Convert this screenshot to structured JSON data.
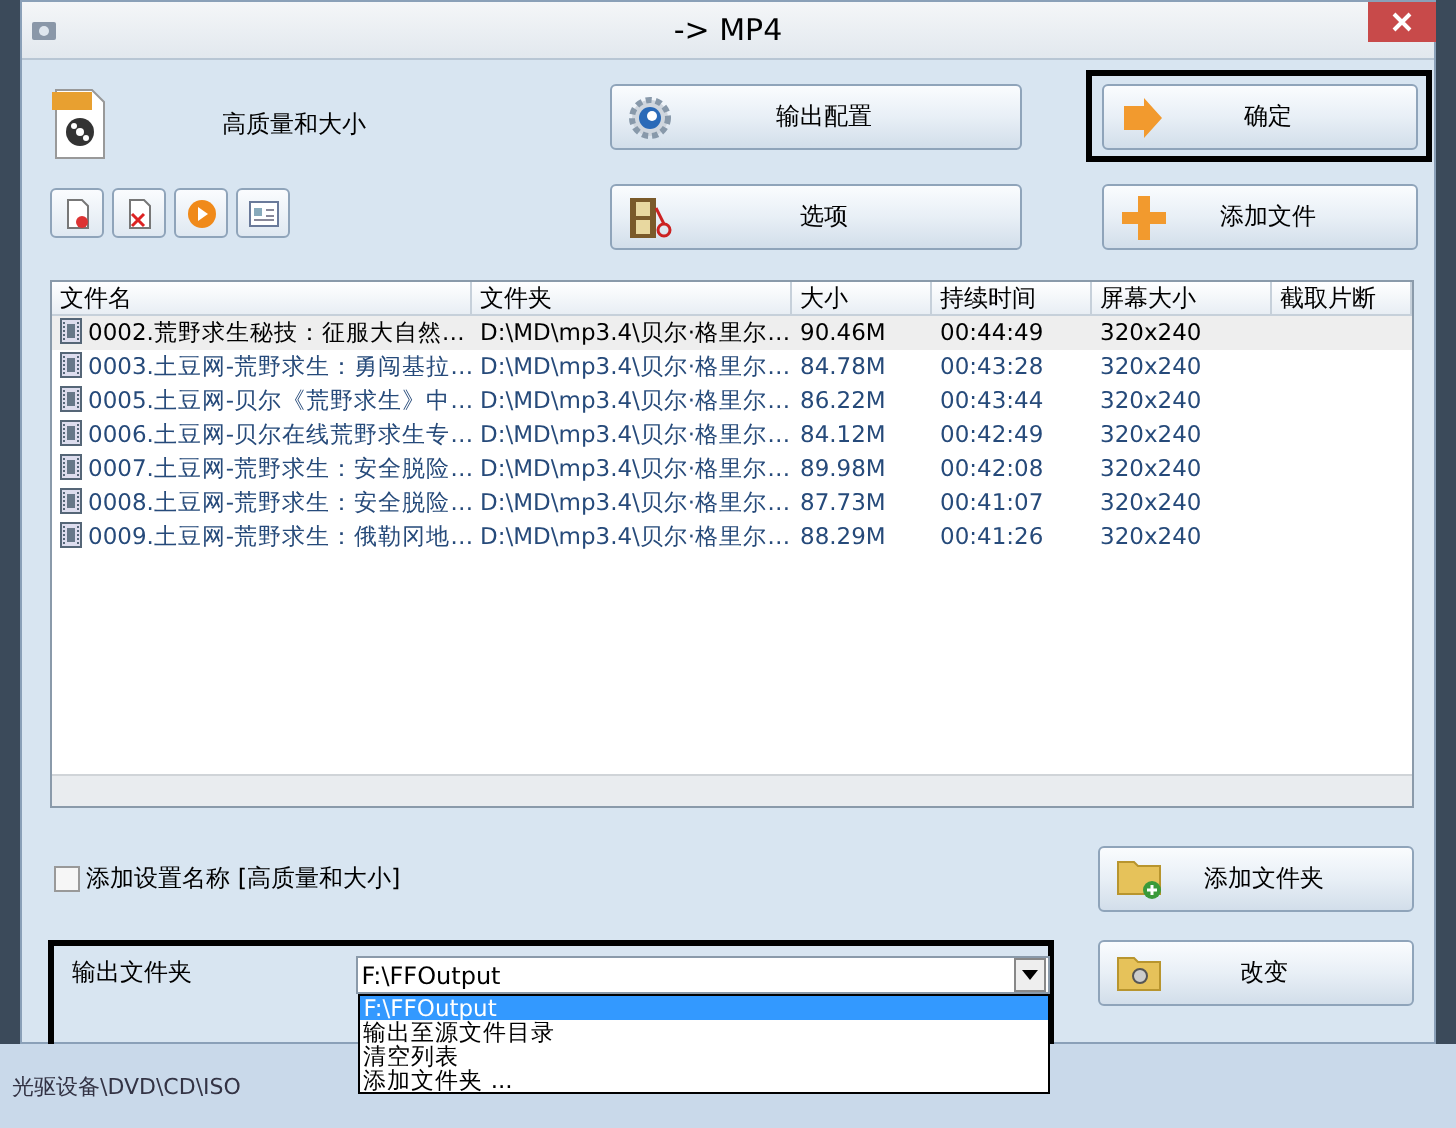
{
  "window": {
    "title": "-> MP4"
  },
  "profile": {
    "label": "高质量和大小"
  },
  "toolbar": [
    {
      "kind": "remove"
    },
    {
      "kind": "clear"
    },
    {
      "kind": "play"
    },
    {
      "kind": "info"
    }
  ],
  "buttons": [
    {
      "label": "输出配置",
      "kind": "config",
      "highlighted": false
    },
    {
      "label": "确定",
      "kind": "ok",
      "highlighted": true
    },
    {
      "label": "选项",
      "kind": "options",
      "highlighted": false
    },
    {
      "label": "添加文件",
      "kind": "add-file",
      "highlighted": false
    }
  ],
  "file_list": {
    "columns": [
      "文件名",
      "文件夹",
      "大小",
      "持续时间",
      "屏幕大小",
      "截取片断"
    ],
    "rows": [
      {
        "selected": true,
        "cells": [
          "0002.荒野求生秘技：征服大自然…",
          "D:\\MD\\mp3.4\\贝尔·格里尔…",
          "90.46M",
          "00:44:49",
          "320x240"
        ]
      },
      {
        "selected": false,
        "cells": [
          "0003.土豆网-荒野求生：勇闯基拉…",
          "D:\\MD\\mp3.4\\贝尔·格里尔…",
          "84.78M",
          "00:43:28",
          "320x240"
        ]
      },
      {
        "selected": false,
        "cells": [
          "0005.土豆网-贝尔《荒野求生》中…",
          "D:\\MD\\mp3.4\\贝尔·格里尔…",
          "86.22M",
          "00:43:44",
          "320x240"
        ]
      },
      {
        "selected": false,
        "cells": [
          "0006.土豆网-贝尔在线荒野求生专…",
          "D:\\MD\\mp3.4\\贝尔·格里尔…",
          "84.12M",
          "00:42:49",
          "320x240"
        ]
      },
      {
        "selected": false,
        "cells": [
          "0007.土豆网-荒野求生：安全脱险…",
          "D:\\MD\\mp3.4\\贝尔·格里尔…",
          "89.98M",
          "00:42:08",
          "320x240"
        ]
      },
      {
        "selected": false,
        "cells": [
          "0008.土豆网-荒野求生：安全脱险…",
          "D:\\MD\\mp3.4\\贝尔·格里尔…",
          "87.73M",
          "00:41:07",
          "320x240"
        ]
      },
      {
        "selected": false,
        "cells": [
          "0009.土豆网-荒野求生：俄勒冈地…",
          "D:\\MD\\mp3.4\\贝尔·格里尔…",
          "88.29M",
          "00:41:26",
          "320x240"
        ]
      }
    ]
  },
  "add_setting_name": {
    "label": "添加设置名称 [高质量和大小]",
    "checked": false
  },
  "add_folder_button": {
    "label": "添加文件夹",
    "kind": "add-folder"
  },
  "output": {
    "label": "输出文件夹",
    "value": "F:\\FFOutput",
    "highlighted": true,
    "dropdown": {
      "expanded": true,
      "options": [
        {
          "label": "F:\\FFOutput",
          "selected": true
        },
        {
          "label": "输出至源文件目录",
          "selected": false
        },
        {
          "label": "清空列表",
          "selected": false
        },
        {
          "label": "添加文件夹 ...",
          "selected": false
        }
      ]
    }
  },
  "change_button": {
    "label": "改变",
    "kind": "change"
  },
  "background_status": "光驱设备\\DVD\\CD\\ISO"
}
